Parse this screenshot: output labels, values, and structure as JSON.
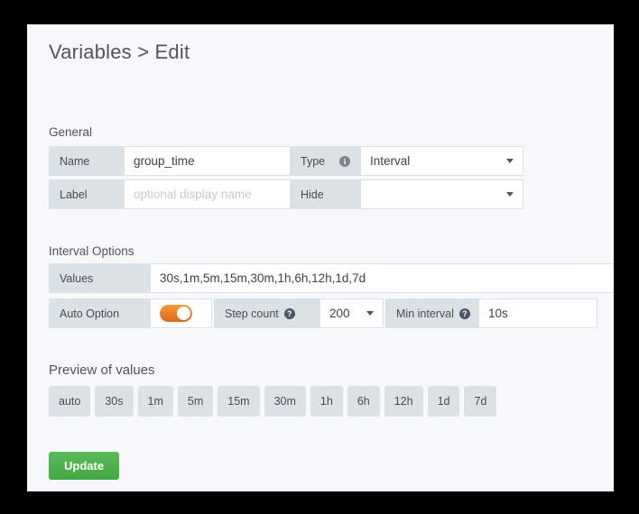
{
  "page": {
    "title": "Variables > Edit"
  },
  "sections": {
    "general": {
      "heading": "General",
      "name": {
        "label": "Name",
        "value": "group_time"
      },
      "label_field": {
        "label": "Label",
        "value": "",
        "placeholder": "optional display name"
      },
      "type": {
        "label": "Type",
        "info_icon": "info-icon",
        "value": "Interval"
      },
      "hide": {
        "label": "Hide",
        "value": ""
      }
    },
    "interval_options": {
      "heading": "Interval Options",
      "values": {
        "label": "Values",
        "value": "30s,1m,5m,15m,30m,1h,6h,12h,1d,7d"
      },
      "auto_option": {
        "label": "Auto Option",
        "enabled": true,
        "toggle_color": "#e8761f"
      },
      "step_count": {
        "label": "Step count",
        "help_icon": "help-icon",
        "value": "200"
      },
      "min_interval": {
        "label": "Min interval",
        "help_icon": "help-icon",
        "value": "10s"
      }
    },
    "preview": {
      "heading": "Preview of values",
      "chips": [
        "auto",
        "30s",
        "1m",
        "5m",
        "15m",
        "30m",
        "1h",
        "6h",
        "12h",
        "1d",
        "7d"
      ]
    }
  },
  "actions": {
    "update_label": "Update",
    "update_color": "#4caf50"
  },
  "icons": {
    "info": "i",
    "help": "?"
  }
}
